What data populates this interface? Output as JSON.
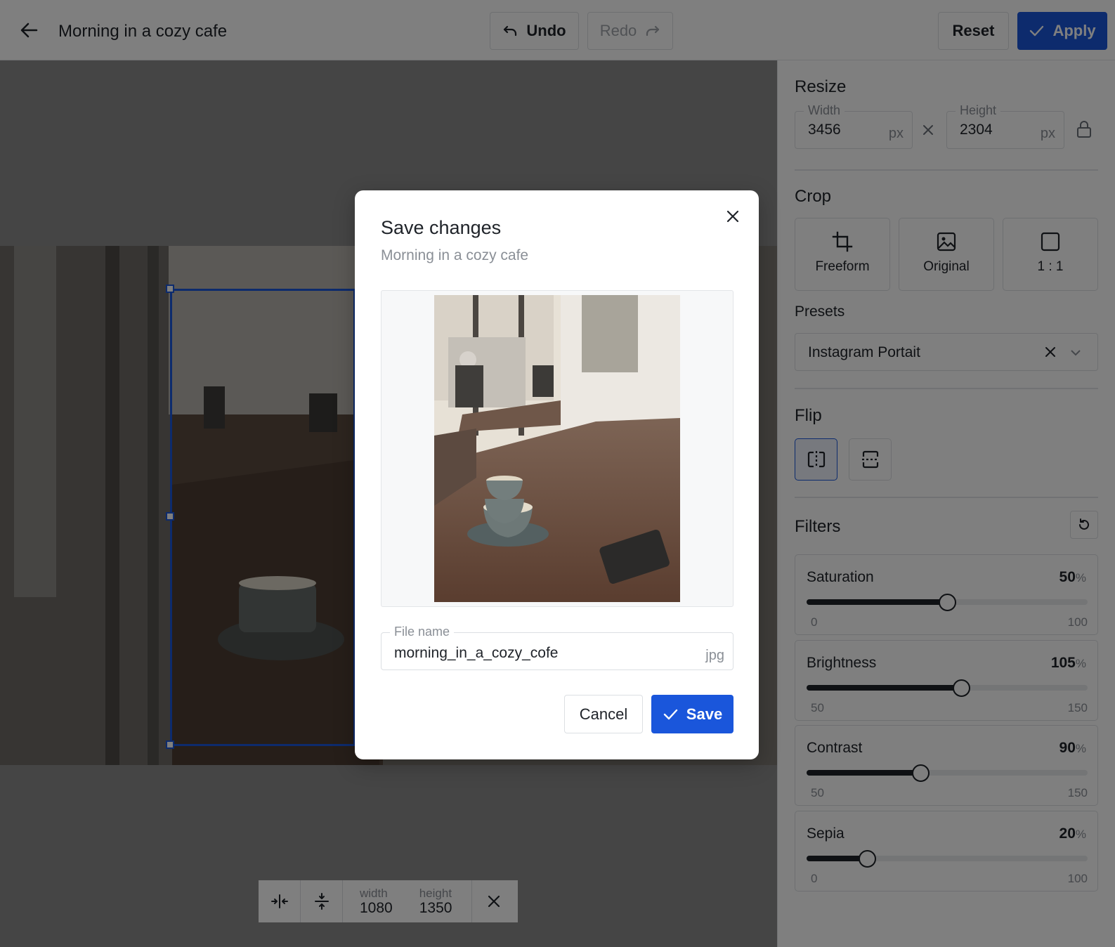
{
  "header": {
    "title": "Morning in a cozy cafe",
    "undo_label": "Undo",
    "redo_label": "Redo",
    "reset_label": "Reset",
    "apply_label": "Apply"
  },
  "panel": {
    "resize": {
      "title": "Resize",
      "width": {
        "label": "Width",
        "value": "3456",
        "unit": "px"
      },
      "height": {
        "label": "Height",
        "value": "2304",
        "unit": "px"
      }
    },
    "crop": {
      "title": "Crop",
      "options": [
        {
          "label": "Freeform",
          "icon": "crop-icon"
        },
        {
          "label": "Original",
          "icon": "image-icon"
        },
        {
          "label": "1 : 1",
          "icon": "square-icon"
        }
      ]
    },
    "presets": {
      "title": "Presets",
      "selected": "Instagram Portait"
    },
    "flip": {
      "title": "Flip",
      "selected": "horizontal"
    },
    "filters": {
      "title": "Filters",
      "items": [
        {
          "name": "Saturation",
          "value": "50",
          "unit": "%",
          "min": "0",
          "max": "100"
        },
        {
          "name": "Brightness",
          "value": "105",
          "unit": "%",
          "min": "50",
          "max": "150"
        },
        {
          "name": "Contrast",
          "value": "90",
          "unit": "%",
          "min": "50",
          "max": "150"
        },
        {
          "name": "Sepia",
          "value": "20",
          "unit": "%",
          "min": "0",
          "max": "100"
        }
      ]
    }
  },
  "crop_toolbar": {
    "width_label": "width",
    "width_value": "1080",
    "height_label": "height",
    "height_value": "1350"
  },
  "modal": {
    "title": "Save changes",
    "subtitle": "Morning in a cozy cafe",
    "file_name_label": "File name",
    "file_name_value": "morning_in_a_cozy_cofe",
    "file_ext": "jpg",
    "cancel_label": "Cancel",
    "save_label": "Save"
  },
  "colors": {
    "accent": "#1a56db",
    "text": "#1f2329",
    "muted": "#8a8f96",
    "border": "#dcdfe3"
  }
}
